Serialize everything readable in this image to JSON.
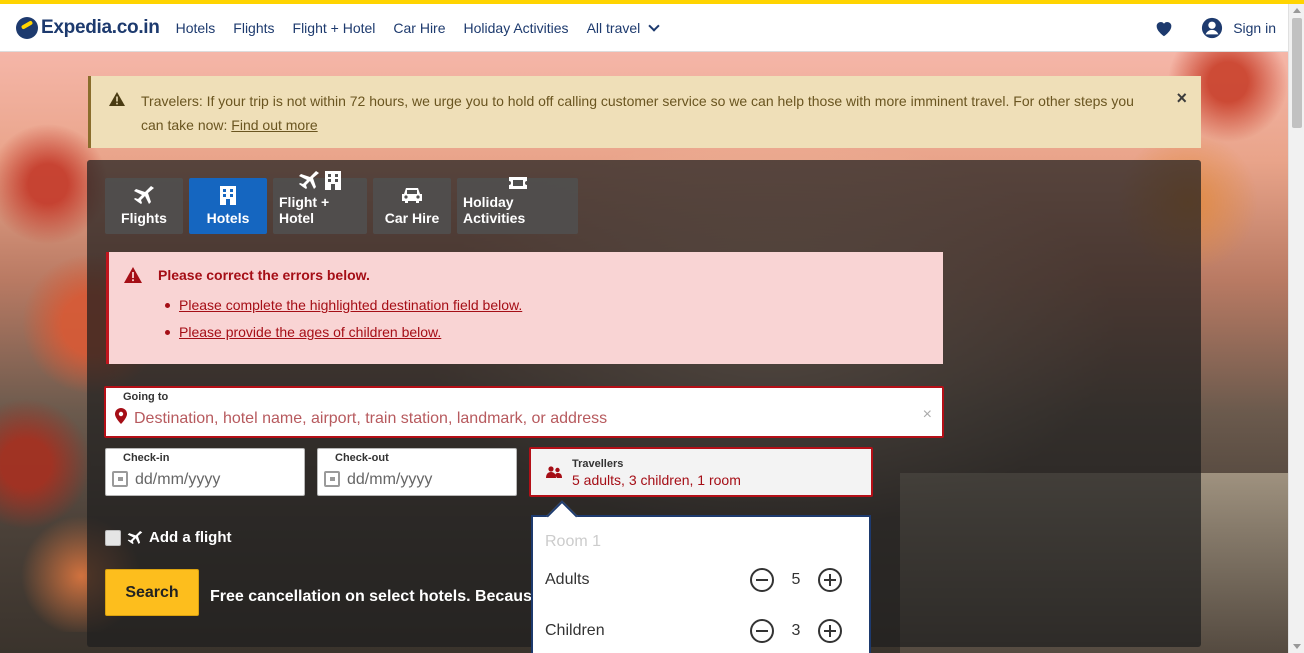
{
  "brand": {
    "logo_text": "Expedia.co.in",
    "accent": "#ffd400",
    "navy": "#1d3a6e",
    "primary": "#1566c0",
    "error": "#a50e16"
  },
  "nav": {
    "items": [
      "Hotels",
      "Flights",
      "Flight + Hotel",
      "Car Hire",
      "Holiday Activities",
      "All travel"
    ],
    "signin": "Sign in"
  },
  "alert": {
    "text": "Travelers: If your trip is not within 72 hours, we urge you to hold off calling customer service so we can help those with more imminent travel. For other steps you can take now: ",
    "link": "Find out more",
    "close": "×"
  },
  "tabs": [
    {
      "label": "Flights",
      "icon": "plane-icon",
      "active": false
    },
    {
      "label": "Hotels",
      "icon": "hotel-icon",
      "active": true
    },
    {
      "label": "Flight + Hotel",
      "icon": "plane-hotel-icon",
      "active": false
    },
    {
      "label": "Car Hire",
      "icon": "car-icon",
      "active": false
    },
    {
      "label": "Holiday Activities",
      "icon": "ticket-icon",
      "active": false
    }
  ],
  "errors": {
    "title": "Please correct the errors below.",
    "items": [
      "Please complete the highlighted destination field below.",
      "Please provide the ages of children below."
    ]
  },
  "destination": {
    "label": "Going to",
    "placeholder": "Destination, hotel name, airport, train station, landmark, or address",
    "clear": "×"
  },
  "checkin": {
    "label": "Check-in",
    "placeholder": "dd/mm/yyyy"
  },
  "checkout": {
    "label": "Check-out",
    "placeholder": "dd/mm/yyyy"
  },
  "travellers": {
    "label": "Travellers",
    "value": "5 adults, 3 children, 1 room"
  },
  "add_flight": "Add a flight",
  "search_label": "Search",
  "free_cancel": "Free cancellation on select hotels. Becaus",
  "popup": {
    "room": "Room 1",
    "adults_label": "Adults",
    "adults_value": "5",
    "children_label": "Children",
    "children_value": "3"
  }
}
